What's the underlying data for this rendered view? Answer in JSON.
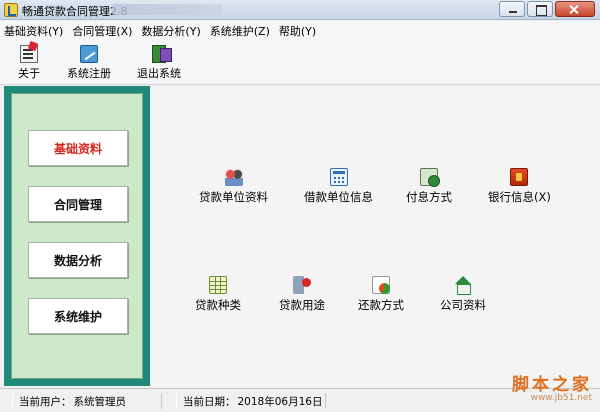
{
  "window": {
    "title": "畅通贷款合同管理2.8"
  },
  "menu": [
    {
      "label": "基础资料(Y)"
    },
    {
      "label": "合同管理(X)"
    },
    {
      "label": "数据分析(Y)"
    },
    {
      "label": "系统维护(Z)"
    },
    {
      "label": "帮助(Y)"
    }
  ],
  "toolbar": {
    "about": {
      "label": "关于",
      "icon": "info-icon"
    },
    "register": {
      "label": "系统注册",
      "icon": "register-icon"
    },
    "exit": {
      "label": "退出系统",
      "icon": "exit-door-icon"
    }
  },
  "sidebar": {
    "items": [
      {
        "label": "基础资料",
        "active": true
      },
      {
        "label": "合同管理",
        "active": false
      },
      {
        "label": "数据分析",
        "active": false
      },
      {
        "label": "系统维护",
        "active": false
      }
    ],
    "colors": {
      "frame": "#1f8a7a",
      "panel": "#cde8c8",
      "active_text": "#d7261b"
    }
  },
  "features": [
    {
      "label": "贷款单位资料",
      "icon": "lender-people-icon"
    },
    {
      "label": "借款单位信息",
      "icon": "borrower-calendar-icon"
    },
    {
      "label": "付息方式",
      "icon": "interest-payment-icon"
    },
    {
      "label": "银行信息(X)",
      "icon": "bank-book-icon"
    },
    {
      "label": "贷款种类",
      "icon": "loan-type-table-icon"
    },
    {
      "label": "贷款用途",
      "icon": "loan-purpose-icon"
    },
    {
      "label": "还款方式",
      "icon": "repayment-chart-icon"
    },
    {
      "label": "公司资料",
      "icon": "company-house-icon"
    }
  ],
  "statusbar": {
    "user_key": "当前用户：",
    "user_value": "系统管理员",
    "date_key": "当前日期：",
    "date_value": "2018年06月16日"
  },
  "watermark": {
    "main": "脚本之家",
    "sub": "www.jb51.net"
  }
}
